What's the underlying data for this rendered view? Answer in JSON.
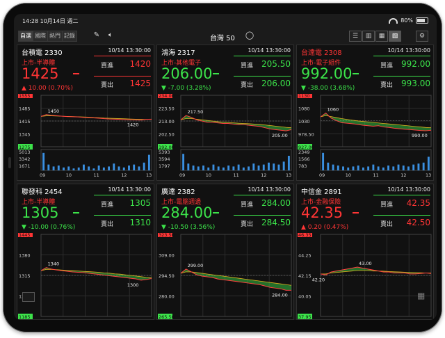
{
  "status": {
    "time": "14:28",
    "date": "10月14日 週二",
    "battery": "80%"
  },
  "toolbar": {
    "tabs": [
      {
        "label": "自選",
        "active": true
      },
      {
        "label": "國際",
        "active": false
      },
      {
        "label": "熱門",
        "active": false
      },
      {
        "label": "記錄",
        "active": false
      }
    ],
    "title": "台灣 50",
    "edit_icon": "pencil-icon",
    "sound_icon": "speaker-icon",
    "search_icon": "search-icon",
    "view_icons": [
      "list-view-icon",
      "two-column-icon",
      "grid-view-icon",
      "chart-view-icon"
    ],
    "settings_icon": "settings-icon"
  },
  "labels": {
    "bid": "買進",
    "ask": "賣出"
  },
  "colors": {
    "up": "#ff3535",
    "down": "#3ce34a",
    "background": "#111111"
  },
  "cards": [
    {
      "name": "台積電 2330",
      "name_color": "white",
      "time": "10/14 13:30:00",
      "sector": "上市-半導體",
      "sector_color": "red",
      "price": "1425",
      "price_color": "red",
      "flat_color": "red",
      "change": "▲ 10.00 (0.70%)",
      "change_color": "red",
      "bid": "1420",
      "bid_color": "red",
      "ask": "1425",
      "ask_color": "red",
      "top_line": "red",
      "bottom_line": "red",
      "chart": {
        "yticks": [
          "1555",
          "1485",
          "1415",
          "1345",
          "1275"
        ],
        "ytick_boxes": {
          "0": "red",
          "4": "green"
        },
        "vol_ticks": [
          "5013",
          "3342",
          "1671"
        ],
        "xticks": [
          "09",
          "10",
          "11",
          "12",
          "13"
        ],
        "high_label": "1450",
        "low_label": "1420",
        "ymin": 1275,
        "ymax": 1555,
        "ref": 1415,
        "ref_price_color": "red",
        "prices": [
          1440,
          1450,
          1446,
          1444,
          1441,
          1439,
          1438,
          1437,
          1435,
          1434,
          1432,
          1430,
          1428,
          1426,
          1425,
          1424,
          1423,
          1422,
          1421,
          1420,
          1424,
          1425
        ],
        "avg": [
          1440,
          1443,
          1443,
          1442,
          1441,
          1440,
          1439,
          1438,
          1437,
          1436,
          1434,
          1433,
          1431,
          1430,
          1429,
          1428,
          1427,
          1426,
          1425,
          1424,
          1424,
          1424
        ],
        "volumes": [
          0.9,
          0.3,
          0.2,
          0.25,
          0.15,
          0.2,
          0.1,
          0.15,
          0.3,
          0.2,
          0.1,
          0.25,
          0.15,
          0.2,
          0.35,
          0.2,
          0.15,
          0.25,
          0.3,
          0.2,
          0.4,
          0.8
        ]
      }
    },
    {
      "name": "鴻海 2317",
      "name_color": "white",
      "time": "10/14 13:30:00",
      "sector": "上市-其他電子",
      "sector_color": "red",
      "price": "206.00",
      "price_color": "green",
      "flat_color": "green",
      "change": "▼ -7.00 (3.28%)",
      "change_color": "green",
      "bid": "205.50",
      "bid_color": "green",
      "ask": "206.00",
      "ask_color": "green",
      "top_line": "green",
      "bottom_line": "green",
      "chart": {
        "yticks": [
          "234.00",
          "223.50",
          "213.00",
          "202.50",
          "192.00"
        ],
        "ytick_boxes": {
          "0": "red",
          "4": "green"
        },
        "vol_ticks": [
          "5393",
          "3594",
          "1797"
        ],
        "xticks": [
          "09",
          "10",
          "11",
          "12",
          "13"
        ],
        "high_label": "217.50",
        "low_label": "205.00",
        "ymin": 192,
        "ymax": 234,
        "ref": 213,
        "ref_price_color": "red",
        "prices": [
          214,
          217.5,
          216,
          214,
          213,
          212,
          212,
          211.5,
          211,
          211,
          210.5,
          210,
          210,
          209.5,
          209,
          208.5,
          207.5,
          206.5,
          206,
          205.5,
          205,
          206
        ],
        "avg": [
          214,
          215,
          215,
          214.5,
          214,
          213.5,
          213,
          212.5,
          212,
          211.8,
          211.5,
          211.2,
          211,
          210.8,
          210.5,
          210.2,
          209.8,
          209.3,
          208.8,
          208.3,
          207.8,
          207.5
        ],
        "volumes": [
          0.85,
          0.35,
          0.25,
          0.2,
          0.25,
          0.15,
          0.3,
          0.2,
          0.15,
          0.25,
          0.2,
          0.3,
          0.15,
          0.2,
          0.35,
          0.25,
          0.3,
          0.4,
          0.35,
          0.3,
          0.45,
          0.75
        ]
      }
    },
    {
      "name": "台達電 2308",
      "name_color": "red",
      "time": "10/14 13:30:00",
      "sector": "上市-電子組件",
      "sector_color": "red",
      "price": "992.00",
      "price_color": "green",
      "flat_color": "green",
      "change": "▼ -38.00 (3.68%)",
      "change_color": "green",
      "bid": "992.00",
      "bid_color": "green",
      "ask": "993.00",
      "ask_color": "green",
      "top_line": "green",
      "bottom_line": "green",
      "chart": {
        "yticks": [
          "1130",
          "1080",
          "1030",
          "978.50",
          "927.00"
        ],
        "ytick_boxes": {
          "0": "red",
          "4": "green"
        },
        "vol_ticks": [
          "2349",
          "1566",
          "783"
        ],
        "xticks": [
          "09",
          "10",
          "11",
          "12",
          "13"
        ],
        "high_label": "1060",
        "low_label": "990.00",
        "ymin": 927,
        "ymax": 1130,
        "ref": 1030,
        "ref_price_color": "red",
        "prices": [
          1045,
          1060,
          1040,
          1030,
          1022,
          1020,
          1018,
          1015,
          1012,
          1010,
          1008,
          1010,
          1005,
          1003,
          1000,
          998,
          996,
          995,
          993,
          991,
          990,
          992
        ],
        "avg": [
          1045,
          1050,
          1046,
          1042,
          1038,
          1035,
          1032,
          1029,
          1027,
          1025,
          1023,
          1021,
          1019,
          1017,
          1015,
          1013,
          1011,
          1009,
          1007,
          1005,
          1003,
          1002
        ],
        "volumes": [
          0.9,
          0.4,
          0.3,
          0.25,
          0.2,
          0.15,
          0.2,
          0.25,
          0.15,
          0.2,
          0.3,
          0.2,
          0.15,
          0.25,
          0.2,
          0.3,
          0.25,
          0.2,
          0.3,
          0.35,
          0.4,
          0.7
        ]
      }
    },
    {
      "name": "聯發科 2454",
      "name_color": "white",
      "time": "10/14 13:30:00",
      "sector": "上市-半導體",
      "sector_color": "red",
      "price": "1305",
      "price_color": "green",
      "flat_color": "green",
      "change": "▼ -10.00 (0.76%)",
      "change_color": "green",
      "bid": "1305",
      "bid_color": "green",
      "ask": "1310",
      "ask_color": "green",
      "top_line": "green",
      "bottom_line": "green",
      "chart": {
        "yticks": [
          "1445",
          "1380",
          "1315",
          "1250",
          "1185"
        ],
        "ytick_boxes": {
          "0": "red",
          "4": "green"
        },
        "vol_ticks": [],
        "xticks": [],
        "high_label": "1340",
        "low_label": "1300",
        "ymin": 1185,
        "ymax": 1445,
        "ref": 1315,
        "ref_price_color": "red",
        "prices": [
          1330,
          1340,
          1335,
          1332,
          1330,
          1328,
          1326,
          1325,
          1324,
          1322,
          1320,
          1318,
          1316,
          1314,
          1312,
          1310,
          1308,
          1306,
          1304,
          1300,
          1302,
          1305
        ],
        "avg": [
          1330,
          1334,
          1334,
          1333,
          1332,
          1331,
          1330,
          1329,
          1328,
          1327,
          1326,
          1325,
          1323,
          1322,
          1320,
          1319,
          1317,
          1315,
          1313,
          1311,
          1309,
          1308
        ],
        "volumes": []
      }
    },
    {
      "name": "廣達 2382",
      "name_color": "white",
      "time": "10/14 13:30:00",
      "sector": "上市-電腦週邊",
      "sector_color": "red",
      "price": "284.00",
      "price_color": "green",
      "flat_color": "green",
      "change": "▼ -10.50 (3.56%)",
      "change_color": "green",
      "bid": "284.00",
      "bid_color": "green",
      "ask": "284.50",
      "ask_color": "green",
      "top_line": "green",
      "bottom_line": "green",
      "chart": {
        "yticks": [
          "323.50",
          "309.00",
          "294.50",
          "280.00",
          "265.50"
        ],
        "ytick_boxes": {
          "0": "red",
          "4": "green"
        },
        "vol_ticks": [],
        "xticks": [],
        "high_label": "299.00",
        "low_label": "284.00",
        "ymin": 265.5,
        "ymax": 323.5,
        "ref": 294.5,
        "ref_price_color": "red",
        "prices": [
          296,
          299,
          297,
          295,
          294,
          293.5,
          293,
          292,
          291.5,
          291,
          290.5,
          290,
          289.5,
          289,
          288.5,
          288,
          287,
          286,
          285.5,
          285,
          284,
          284
        ],
        "avg": [
          296,
          297,
          297,
          296.5,
          296,
          295.5,
          295,
          294.5,
          294,
          293.5,
          293,
          292.5,
          292,
          291.5,
          291,
          290.5,
          290,
          289.5,
          289,
          288.5,
          288,
          287.5
        ],
        "volumes": []
      }
    },
    {
      "name": "中信金 2891",
      "name_color": "white",
      "time": "10/14 13:30:00",
      "sector": "上市-金融保險",
      "sector_color": "red",
      "price": "42.35",
      "price_color": "red",
      "flat_color": "red",
      "change": "▲ 0.20 (0.47%)",
      "change_color": "red",
      "bid": "42.35",
      "bid_color": "red",
      "ask": "42.50",
      "ask_color": "red",
      "top_line": "green",
      "bottom_line": "green",
      "chart": {
        "yticks": [
          "46.35",
          "44.25",
          "42.15",
          "40.05",
          "37.95"
        ],
        "ytick_boxes": {
          "0": "red",
          "4": "green"
        },
        "vol_ticks": [],
        "xticks": [],
        "high_label": "43.00",
        "low_label": "42.20",
        "ymin": 37.95,
        "ymax": 46.35,
        "ref": 42.15,
        "ref_price_color": "red",
        "prices": [
          42.3,
          42.2,
          42.5,
          42.6,
          42.7,
          42.8,
          42.9,
          43.0,
          42.9,
          42.8,
          42.7,
          42.6,
          42.5,
          42.5,
          42.4,
          42.4,
          42.4,
          42.3,
          42.3,
          42.35,
          42.4,
          42.35
        ],
        "avg": [
          42.3,
          42.3,
          42.4,
          42.45,
          42.5,
          42.55,
          42.6,
          42.65,
          42.65,
          42.65,
          42.6,
          42.6,
          42.58,
          42.55,
          42.52,
          42.5,
          42.48,
          42.45,
          42.43,
          42.42,
          42.4,
          42.4
        ],
        "volumes": []
      }
    }
  ]
}
